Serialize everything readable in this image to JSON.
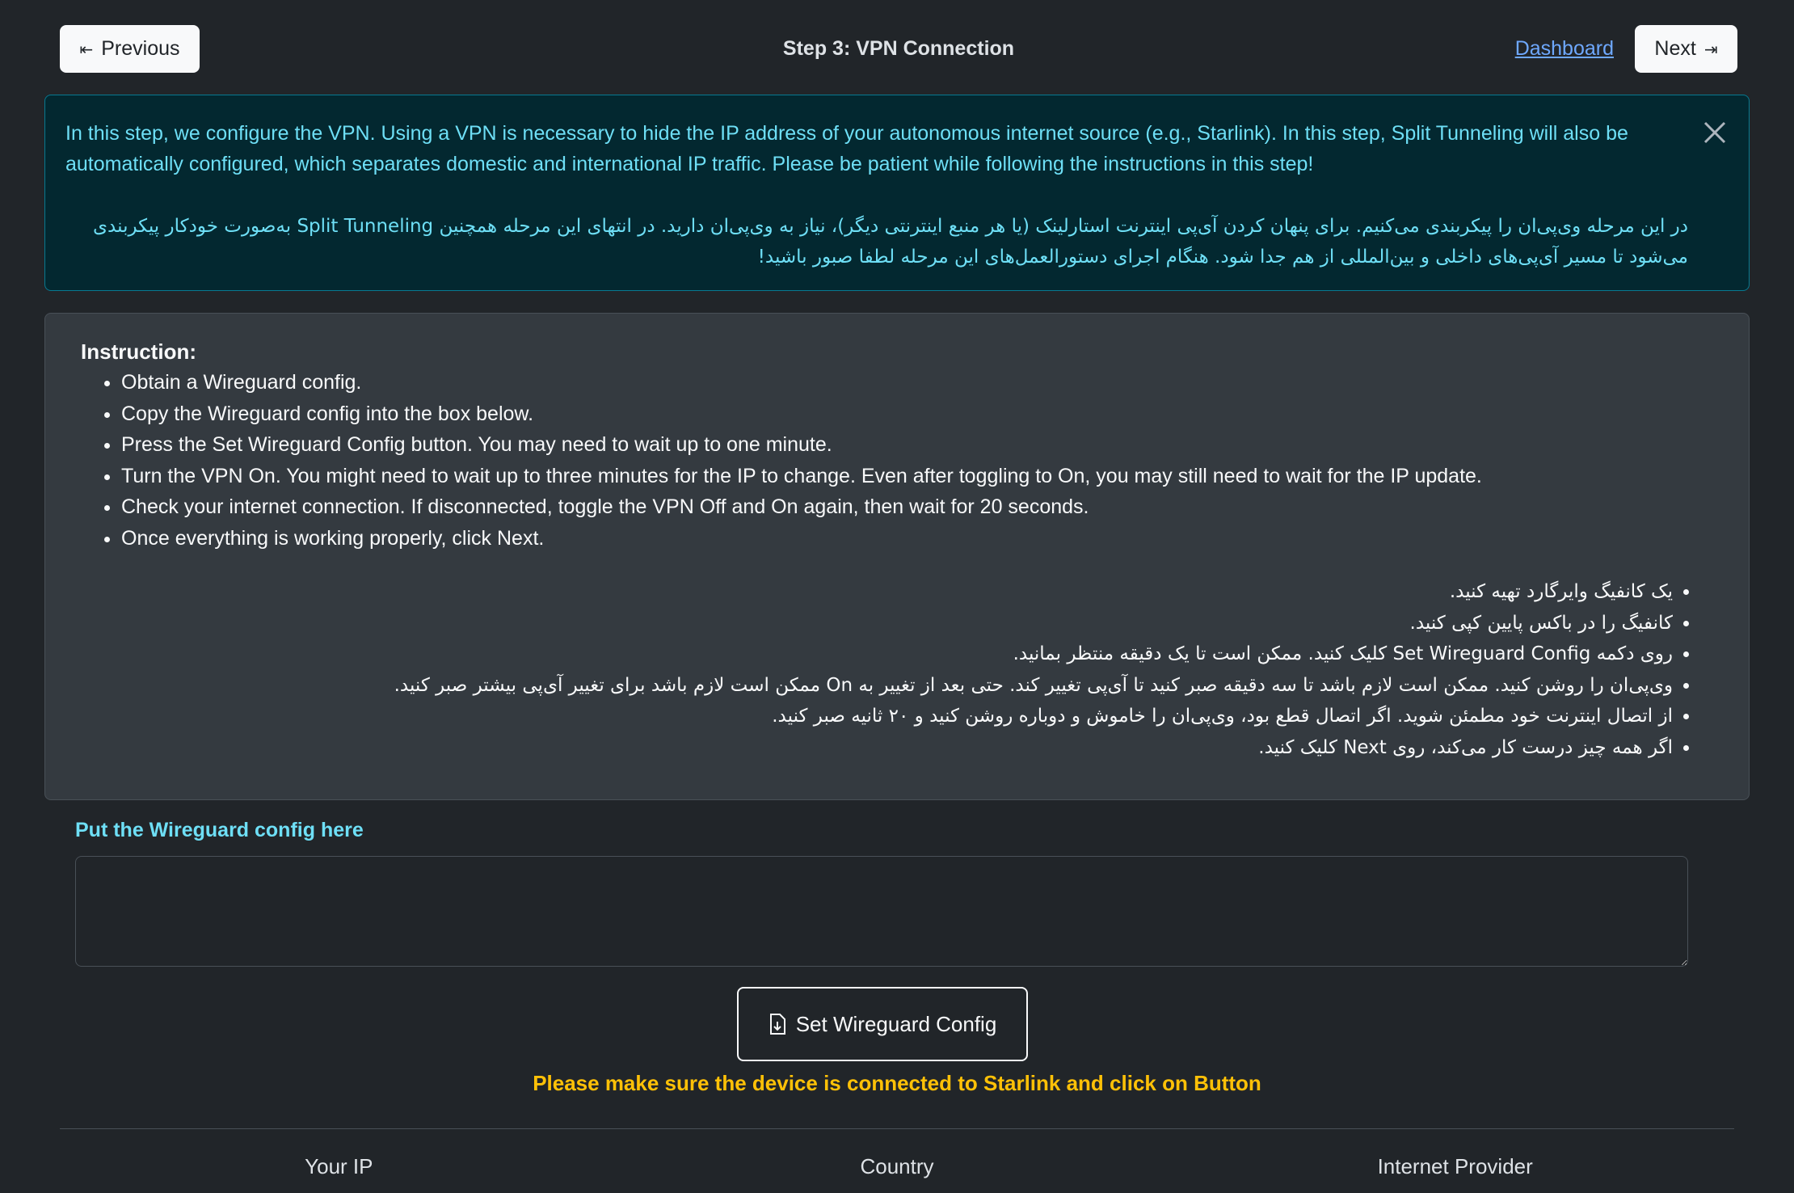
{
  "nav": {
    "previous_label": "Previous",
    "title": "Step 3: VPN Connection",
    "dashboard_label": "Dashboard",
    "next_label": "Next"
  },
  "alert": {
    "english": "In this step, we configure the VPN. Using a VPN is necessary to hide the IP address of your autonomous internet source (e.g., Starlink). In this step, Split Tunneling will also be automatically configured, which separates domestic and international IP traffic. Please be patient while following the instructions in this step!",
    "persian": "در این مرحله وی‌پی‌ان را پیکربندی می‌کنیم. برای پنهان کردن آی‌پی اینترنت استارلینک (یا هر منبع اینترنتی دیگر)، نیاز به وی‌پی‌ان دارید. در انتهای این مرحله همچنین Split Tunneling به‌صورت خودکار پیکربندی می‌شود تا مسیر آی‌پی‌های داخلی و بین‌المللی از هم جدا شود. هنگام اجرای دستورالعمل‌های این مرحله لطفا صبور باشید!"
  },
  "instructions": {
    "title": "Instruction:",
    "english": [
      "Obtain a Wireguard config.",
      "Copy the Wireguard config into the box below.",
      "Press the Set Wireguard Config button. You may need to wait up to one minute.",
      "Turn the VPN On. You might need to wait up to three minutes for the IP to change. Even after toggling to On, you may still need to wait for the IP update.",
      "Check your internet connection. If disconnected, toggle the VPN Off and On again, then wait for 20 seconds.",
      "Once everything is working properly, click Next."
    ],
    "persian": [
      "یک کانفیگ وایرگارد تهیه کنید.",
      "کانفیگ را در باکس پایین کپی کنید.",
      "روی دکمه Set Wireguard Config کلیک کنید. ممکن است تا یک دقیقه منتظر بمانید.",
      "وی‌پی‌ان را روشن کنید. ممکن است لازم باشد تا سه دقیقه صبر کنید تا آی‌پی تغییر کند. حتی بعد از تغییر به On ممکن است لازم باشد برای تغییر آی‌پی بیشتر صبر کنید.",
      "از اتصال اینترنت خود مطمئن شوید. اگر اتصال قطع بود، وی‌پی‌ان را خاموش و دوباره روشن کنید و ۲۰ ثانیه صبر کنید.",
      "اگر همه چیز درست کار می‌کند، روی Next کلیک کنید."
    ]
  },
  "config": {
    "label": "Put the Wireguard config here",
    "value": "",
    "button_label": "Set Wireguard Config"
  },
  "warning": "Please make sure the device is connected to Starlink and click on Button",
  "stats": {
    "ip_label": "Your IP",
    "country_label": "Country",
    "provider_label": "Internet Provider"
  },
  "colors": {
    "background": "#212529",
    "alert_bg": "#032830",
    "alert_text": "#6edff6",
    "link": "#6ea8fe",
    "warning": "#ffc107"
  }
}
